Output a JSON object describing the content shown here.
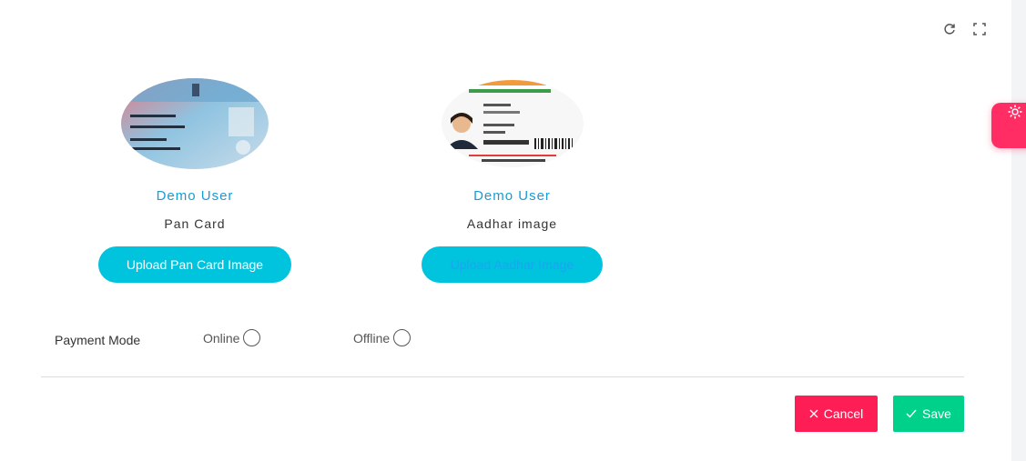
{
  "documents": [
    {
      "user_name": "Demo User",
      "doc_label": "Pan Card",
      "upload_label": "Upload Pan Card Image",
      "image_icon": "pan-card-thumbnail"
    },
    {
      "user_name": "Demo User",
      "doc_label": "Aadhar image",
      "upload_label": "Upload Aadhar Image",
      "image_icon": "aadhar-card-thumbnail"
    }
  ],
  "payment": {
    "label": "Payment Mode",
    "options": [
      "Online",
      "Offline"
    ],
    "selected": null
  },
  "actions": {
    "cancel_label": "Cancel",
    "save_label": "Save"
  },
  "colors": {
    "accent_cyan": "#00c3de",
    "name_blue": "#1a9ad6",
    "cancel_red": "#ff1d55",
    "save_green": "#00d18a",
    "settings_pink": "#ff2d63"
  },
  "icons": [
    "refresh-icon",
    "fullscreen-icon",
    "gear-icon",
    "close-icon",
    "check-icon"
  ]
}
